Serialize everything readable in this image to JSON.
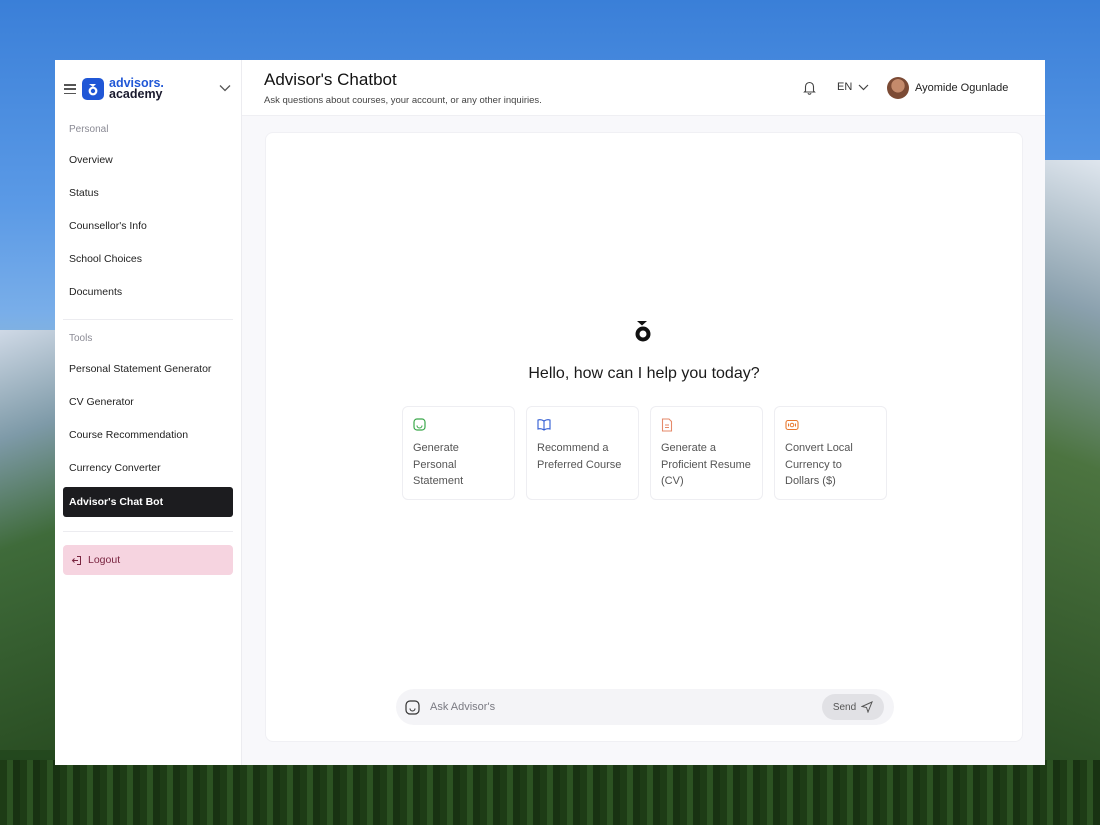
{
  "brand": {
    "line1": "advisors.",
    "line2": "academy"
  },
  "sidebar": {
    "personal_label": "Personal",
    "personal_items": [
      {
        "label": "Overview"
      },
      {
        "label": "Status"
      },
      {
        "label": "Counsellor's Info"
      },
      {
        "label": "School Choices"
      },
      {
        "label": "Documents"
      }
    ],
    "tools_label": "Tools",
    "tools_items": [
      {
        "label": "Personal Statement Generator"
      },
      {
        "label": "CV Generator"
      },
      {
        "label": "Course Recommendation"
      },
      {
        "label": "Currency Converter"
      },
      {
        "label": "Advisor's Chat Bot",
        "active": true
      }
    ],
    "logout_label": "Logout"
  },
  "header": {
    "title": "Advisor's Chatbot",
    "subtitle": "Ask questions about courses, your account, or any other inquiries.",
    "language": "EN",
    "user_name": "Ayomide Ogunlade"
  },
  "chat": {
    "greeting": "Hello, how can I help you today?",
    "suggestions": [
      {
        "label": "Generate Personal Statement",
        "icon": "sticker-icon",
        "color": "#3aa84a"
      },
      {
        "label": "Recommend a Preferred Course",
        "icon": "book-icon",
        "color": "#2f5bd3"
      },
      {
        "label": "Generate a Proficient Resume (CV)",
        "icon": "document-icon",
        "color": "#e58a6a"
      },
      {
        "label": "Convert Local Currency to Dollars ($)",
        "icon": "currency-icon",
        "color": "#e8782f"
      }
    ],
    "input_placeholder": "Ask Advisor's",
    "send_label": "Send"
  },
  "colors": {
    "brand": "#2057d6",
    "active_nav": "#1c1c1f",
    "logout_bg": "#f6d4e0"
  }
}
